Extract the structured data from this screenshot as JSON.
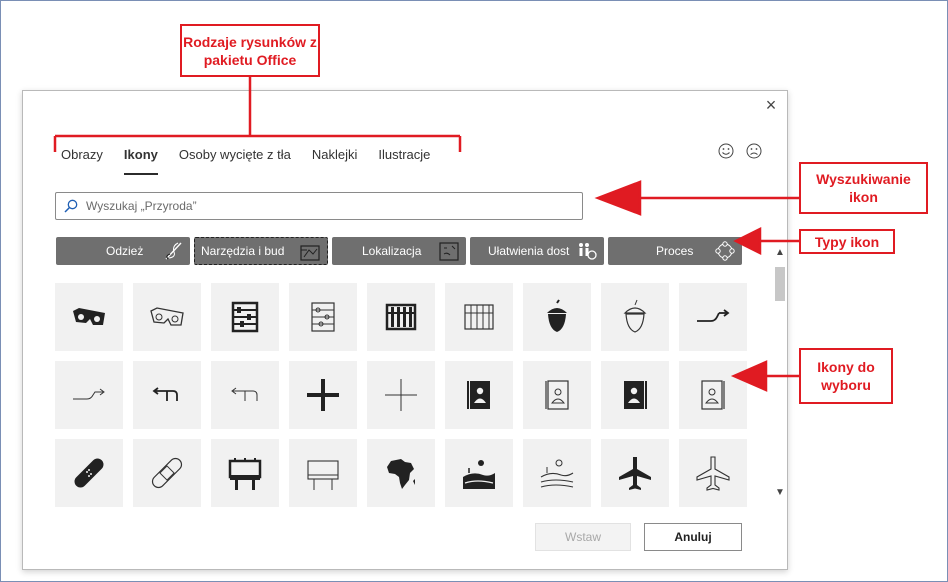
{
  "dialog": {
    "close_label": "×",
    "tabs": [
      {
        "label": "Obrazy",
        "active": false
      },
      {
        "label": "Ikony",
        "active": true
      },
      {
        "label": "Osoby wycięte z tła",
        "active": false
      },
      {
        "label": "Naklejki",
        "active": false
      },
      {
        "label": "Ilustracje",
        "active": false
      }
    ],
    "feedback": [
      "smile-face-icon",
      "frown-face-icon"
    ],
    "search": {
      "placeholder": "Wyszukaj „Przyroda”",
      "value": ""
    },
    "categories": [
      {
        "label": "Odzież",
        "icon": "needle-thread-icon"
      },
      {
        "label": "Narzędzia i bud",
        "icon": "blueprint-icon"
      },
      {
        "label": "Lokalizacja",
        "icon": "map-icon"
      },
      {
        "label": "Ułatwienia dost",
        "icon": "accessibility-people-icon"
      },
      {
        "label": "Proces",
        "icon": "cycle-icon"
      }
    ],
    "icons": [
      "3d-glasses-filled-icon",
      "3d-glasses-outline-icon",
      "abacus-filled-icon",
      "abacus-outline-icon",
      "abacus-dark-icon",
      "abacus-light-icon",
      "acorn-filled-icon",
      "acorn-outline-icon",
      "right-turn-arrow-icon",
      "right-turn-arrow-thin-icon",
      "left-turn-arrow-icon",
      "left-turn-arrow-thin-icon",
      "plus-bold-icon",
      "plus-thin-icon",
      "address-book-filled-icon",
      "address-book-outline-icon",
      "address-book-dark-icon",
      "address-book-light-icon",
      "bandage-filled-icon",
      "bandage-outline-icon",
      "billboard-filled-icon",
      "billboard-outline-icon",
      "africa-icon",
      "farm-landscape-filled-icon",
      "farm-landscape-outline-icon",
      "airplane-filled-icon",
      "airplane-outline-icon"
    ],
    "buttons": {
      "insert": "Wstaw",
      "cancel": "Anuluj"
    }
  },
  "annotations": {
    "types": "Rodzaje rysunków z pakietu Office",
    "search": "Wyszukiwanie ikon",
    "icon_types": "Typy ikon",
    "choices": "Ikony do wyboru"
  },
  "colors": {
    "annotation": "#e01b22",
    "category_bg": "#6f6f6f",
    "cell_bg": "#f1f1f1"
  }
}
